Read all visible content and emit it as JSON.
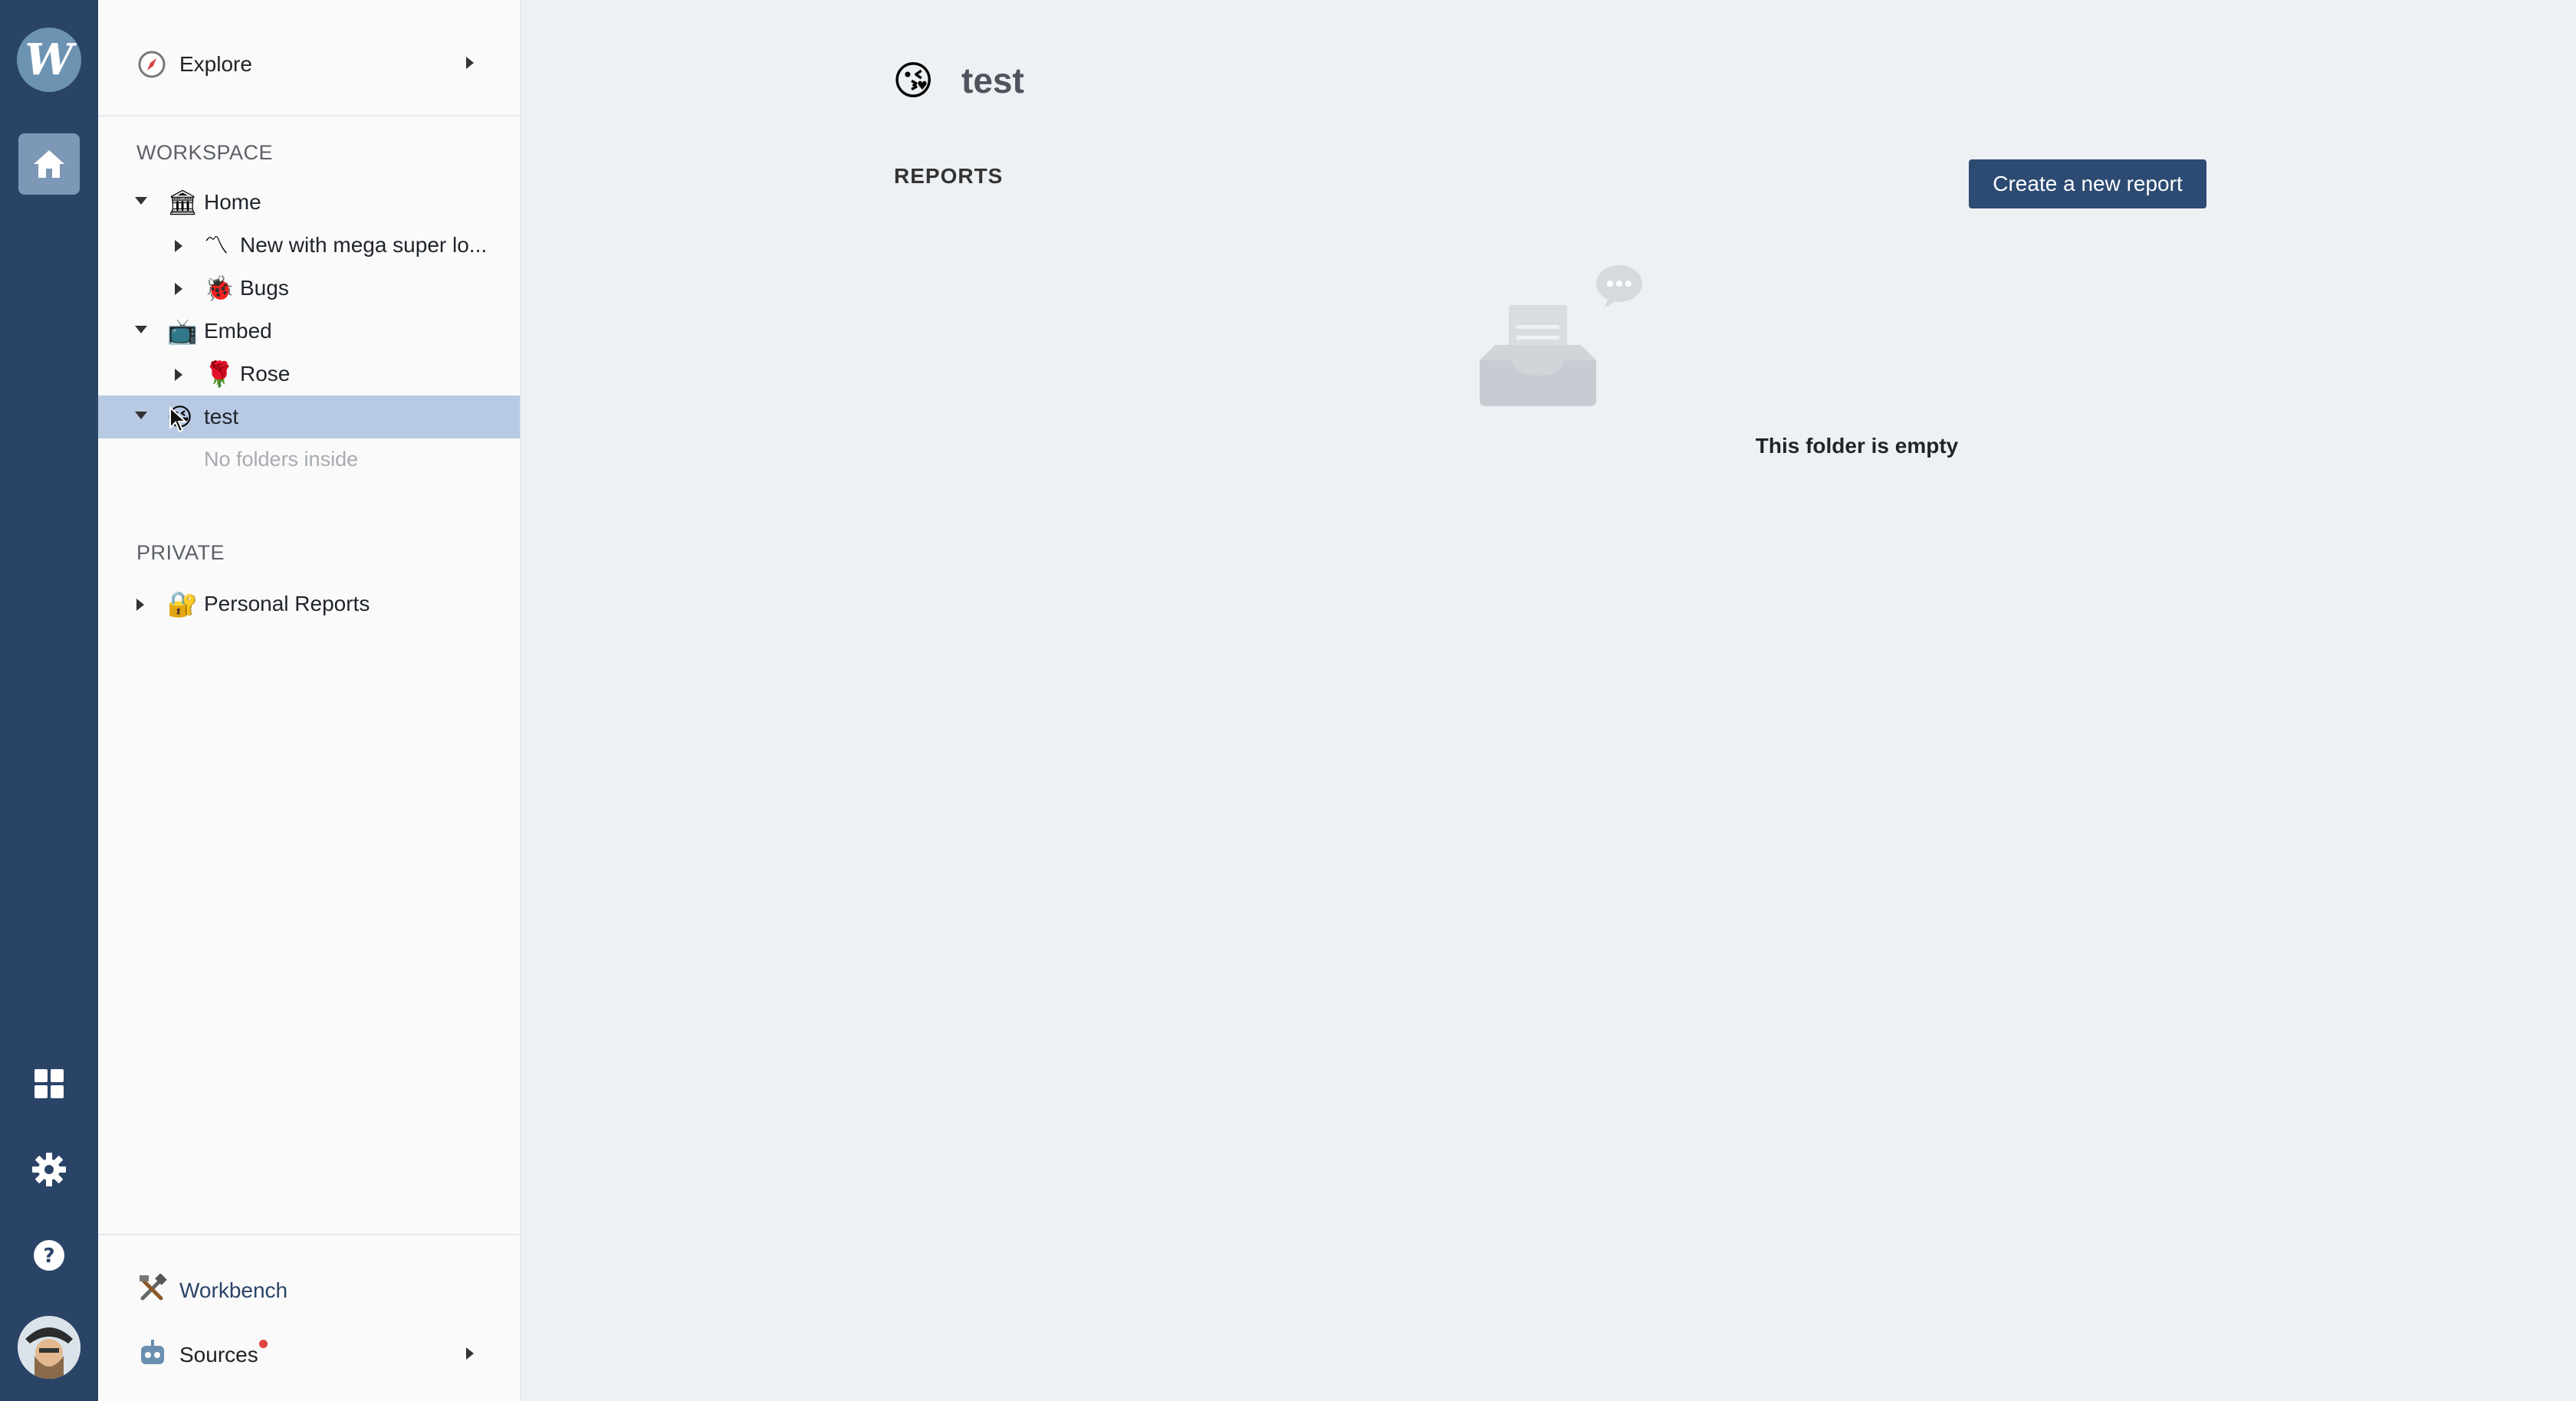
{
  "nav": {
    "logo_letter": "W"
  },
  "sidebar": {
    "explore_label": "Explore",
    "workspace_title": "WORKSPACE",
    "private_title": "PRIVATE",
    "tree": [
      {
        "label": "Home",
        "emoji": "🏛"
      },
      {
        "label": "New with mega super lo...",
        "emoji": "〽"
      },
      {
        "label": "Bugs",
        "emoji": "🐞"
      },
      {
        "label": "Embed",
        "emoji": "📺"
      },
      {
        "label": "Rose",
        "emoji": "🌹"
      },
      {
        "label": "test",
        "emoji": "😘"
      }
    ],
    "no_folders": "No folders inside",
    "private_items": [
      {
        "label": "Personal Reports",
        "emoji": "🔐"
      }
    ],
    "workbench_label": "Workbench",
    "sources_label": "Sources"
  },
  "main": {
    "title": "test",
    "title_emoji": "😘",
    "reports_heading": "REPORTS",
    "create_button": "Create a new report",
    "empty_message": "This folder is empty"
  }
}
